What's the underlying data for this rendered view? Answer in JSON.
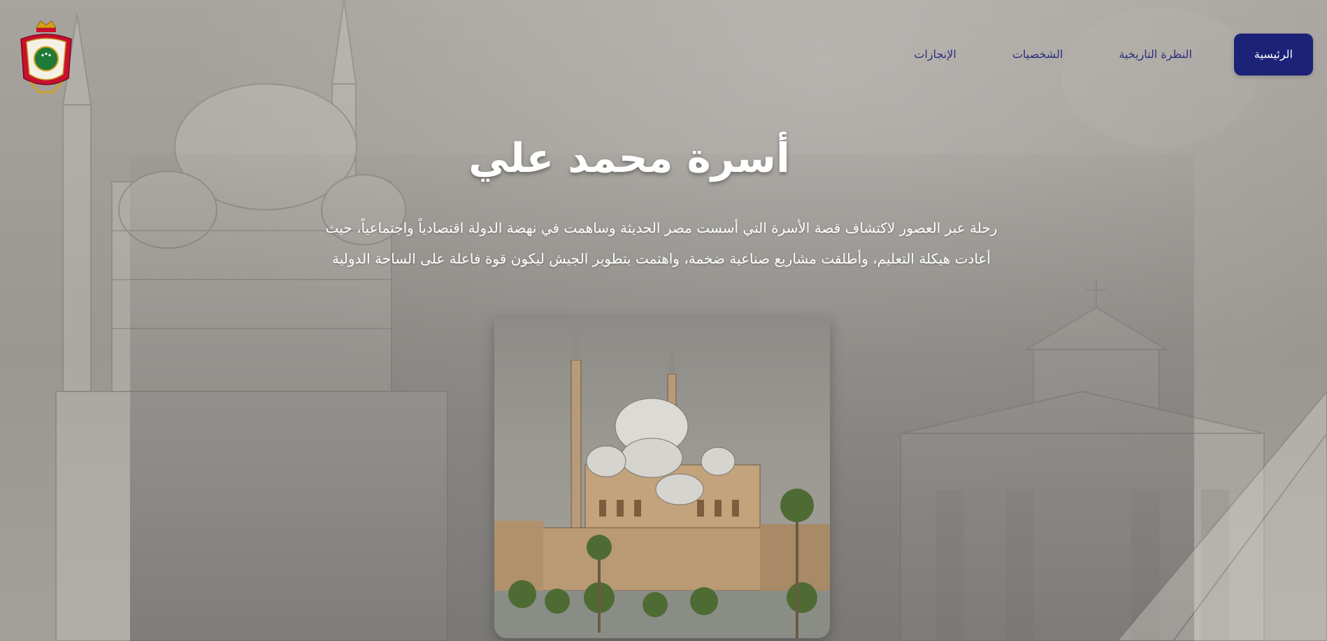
{
  "nav": {
    "items": [
      {
        "label": "الرئيسية",
        "active": true
      },
      {
        "label": "النظرة التاريخية",
        "active": false
      },
      {
        "label": "الشخصيات",
        "active": false
      },
      {
        "label": "الإنجازات",
        "active": false
      }
    ]
  },
  "hero": {
    "title": "أسرة محمد علي",
    "description_line1": "رحلة عبر العصور لاكتشاف قصة الأسرة التي أسست مصر الحديثة وساهمت في نهضة الدولة اقتصادياً واجتماعياً، حيث",
    "description_line2": "أعادت هيكلة التعليم، وأطلقت مشاريع صناعية ضخمة، واهتمت بتطوير الجيش ليكون قوة فاعلة على الساحة الدولية"
  },
  "colors": {
    "nav_active_bg": "#1b2277",
    "nav_text": "#2c2f7a",
    "title_text": "#ffffff"
  },
  "icons": {
    "logo": "royal-coat-of-arms-icon",
    "hero_image": "muhammad-ali-mosque-image"
  }
}
